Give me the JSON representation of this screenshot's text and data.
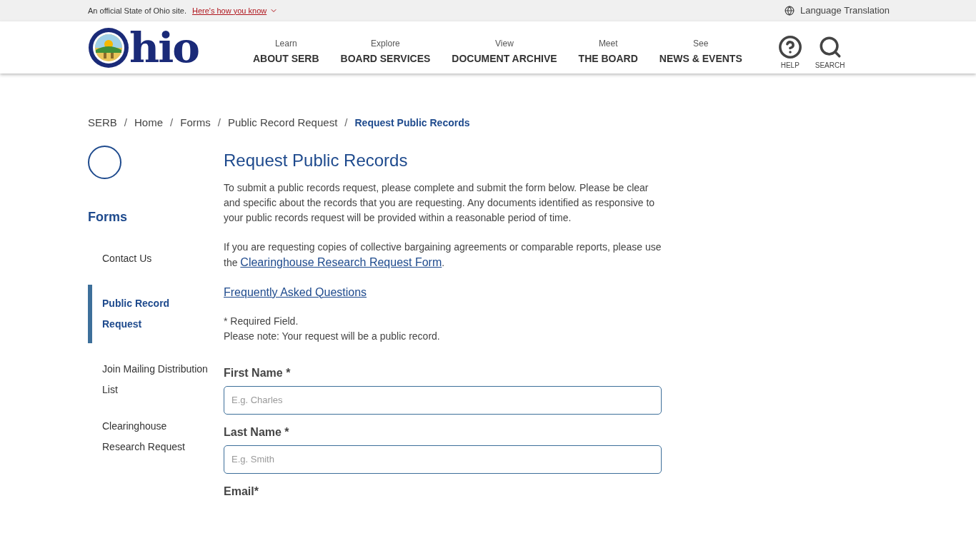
{
  "banner": {
    "text": "An official State of Ohio site.",
    "link": "Here's how you know",
    "language": "Language Translation"
  },
  "logo": {
    "text": "hio"
  },
  "nav": [
    {
      "small": "Learn",
      "label": "ABOUT SERB"
    },
    {
      "small": "Explore",
      "label": "BOARD SERVICES"
    },
    {
      "small": "View",
      "label": "DOCUMENT ARCHIVE"
    },
    {
      "small": "Meet",
      "label": "THE BOARD"
    },
    {
      "small": "See",
      "label": "NEWS & EVENTS"
    }
  ],
  "tools": [
    {
      "kind": "help",
      "label": "HELP"
    },
    {
      "kind": "search",
      "label": "SEARCH"
    }
  ],
  "breadcrumb": [
    {
      "label": "SERB",
      "selected": false
    },
    {
      "separator": "/",
      "label": "Home",
      "selected": false
    },
    {
      "separator": "/",
      "label": "Forms",
      "selected": false
    },
    {
      "separator": "/",
      "label": "Public Record Request",
      "selected": false
    },
    {
      "separator": "/",
      "label": "Request Public Records",
      "selected": true
    }
  ],
  "sidebar": {
    "title": "Forms",
    "items": [
      {
        "label": "Contact Us",
        "selected": false
      },
      {
        "label": "Public Record Request",
        "selected": true
      },
      {
        "label": "Join Mailing Distribution List",
        "selected": false
      },
      {
        "label": "Clearinghouse Research Request",
        "selected": false
      }
    ]
  },
  "page": {
    "title": "Request Public Records",
    "intro": "To submit a public records request, please complete and submit the form below. Please be clear and specific about the records that you are requesting. Any documents identified as responsive to your public records request will be provided within a reasonable period of time.",
    "note_before": "If you are requesting copies of collective bargaining agreements or comparable reports, please use the",
    "note_link": "Clearinghouse Research Request Form",
    "note_after": ".",
    "faq": "Frequently Asked Questions",
    "required": "* Required Field.",
    "public_note": "Please note: Your request will be a public record."
  },
  "fields": [
    {
      "label": "First Name *",
      "placeholder": "E.g. Charles"
    },
    {
      "label": "Last Name *",
      "placeholder": "E.g. Smith"
    },
    {
      "label": "Email*"
    }
  ]
}
